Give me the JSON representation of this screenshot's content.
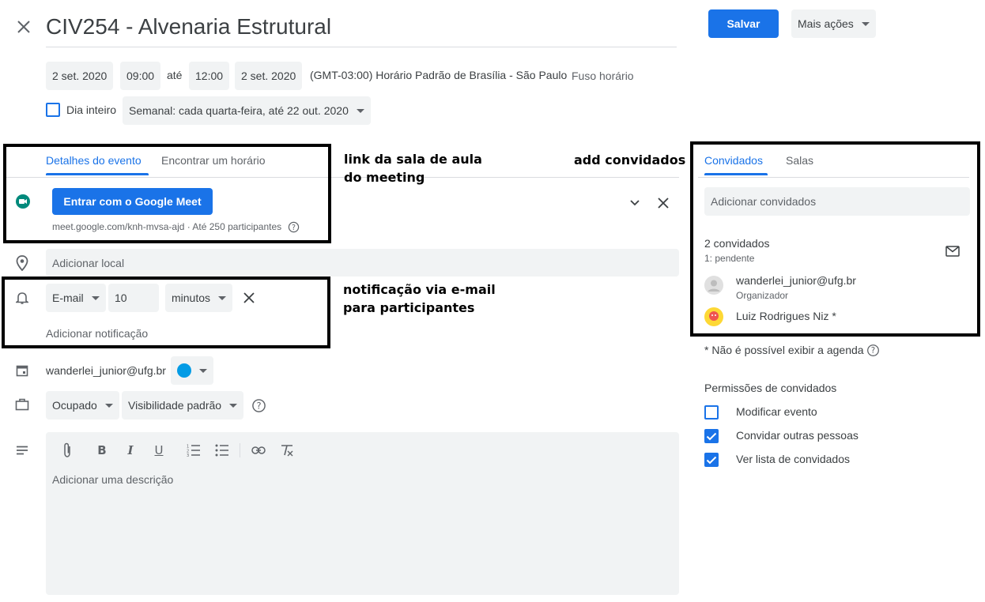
{
  "header": {
    "close_icon": "close-icon",
    "title": "CIV254 - Alvenaria Estrutural",
    "save_label": "Salvar",
    "more_actions_label": "Mais ações"
  },
  "datetime": {
    "start_date": "2 set. 2020",
    "start_time": "09:00",
    "until_label": "até",
    "end_time": "12:00",
    "end_date": "2 set. 2020",
    "timezone_text": "(GMT-03:00) Horário Padrão de Brasília - São Paulo",
    "timezone_link": "Fuso horário",
    "all_day_label": "Dia inteiro",
    "recurrence": "Semanal: cada quarta-feira, até 22 out. 2020"
  },
  "tabs": {
    "details": "Detalhes do evento",
    "find_time": "Encontrar um horário"
  },
  "meet": {
    "button_label": "Entrar com o Google Meet",
    "link_text": "meet.google.com/knh-mvsa-ajd · Até 250 participantes"
  },
  "location": {
    "placeholder": "Adicionar local"
  },
  "notification": {
    "type": "E-mail",
    "value": "10",
    "unit": "minutos",
    "add_label": "Adicionar notificação"
  },
  "calendar": {
    "owner": "wanderlei_junior@ufg.br",
    "color": "#039be5"
  },
  "availability": {
    "status": "Ocupado",
    "visibility": "Visibilidade padrão"
  },
  "description": {
    "placeholder": "Adicionar uma descrição"
  },
  "annotations": {
    "meet_line1": "link da sala de aula",
    "meet_line2": "do meeting",
    "guests": "add convidados",
    "notif_line1": "notificação via e-mail",
    "notif_line2": "para participantes"
  },
  "guests_panel": {
    "tab_guests": "Convidados",
    "tab_rooms": "Salas",
    "add_placeholder": "Adicionar convidados",
    "count": "2 convidados",
    "pending": "1: pendente",
    "guests": [
      {
        "email": "wanderlei_junior@ufg.br",
        "role": "Organizador"
      },
      {
        "email": "Luiz Rodrigues Niz *",
        "role": ""
      }
    ],
    "agenda_note": "* Não é possível exibir a agenda",
    "permissions_title": "Permissões de convidados",
    "permissions": [
      {
        "label": "Modificar evento",
        "checked": false
      },
      {
        "label": "Convidar outras pessoas",
        "checked": true
      },
      {
        "label": "Ver lista de convidados",
        "checked": true
      }
    ]
  },
  "colors": {
    "accent": "#1a73e8",
    "chip_bg": "#f1f3f4",
    "meet_green": "#00897b"
  }
}
